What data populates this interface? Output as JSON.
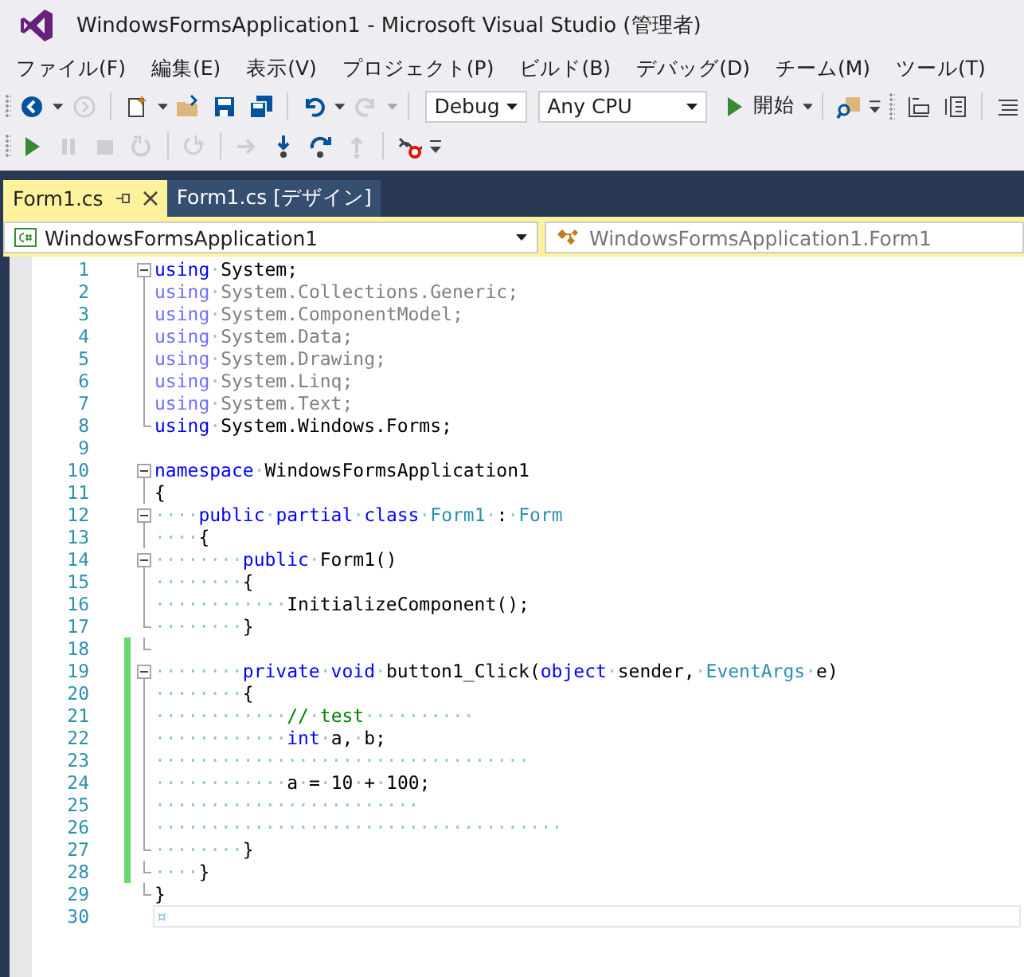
{
  "window": {
    "title": "WindowsFormsApplication1 - Microsoft Visual Studio (管理者)"
  },
  "menu": [
    "ファイル(F)",
    "編集(E)",
    "表示(V)",
    "プロジェクト(P)",
    "ビルド(B)",
    "デバッグ(D)",
    "チーム(M)",
    "ツール(T)"
  ],
  "toolbar_standard": [
    {
      "kind": "back",
      "disabled": false
    },
    {
      "kind": "caret",
      "disabled": false
    },
    {
      "kind": "forward",
      "disabled": true
    },
    {
      "kind": "sep"
    },
    {
      "kind": "new",
      "disabled": false
    },
    {
      "kind": "caret",
      "disabled": false
    },
    {
      "kind": "open",
      "disabled": false
    },
    {
      "kind": "save",
      "disabled": false
    },
    {
      "kind": "saveall",
      "disabled": false
    },
    {
      "kind": "sep"
    },
    {
      "kind": "undo",
      "disabled": false
    },
    {
      "kind": "caret",
      "disabled": false
    },
    {
      "kind": "redo",
      "disabled": true
    },
    {
      "kind": "caret",
      "disabled": true
    },
    {
      "kind": "sep"
    },
    {
      "kind": "combo",
      "value": "Debug"
    },
    {
      "kind": "combo-wide",
      "value": "Any CPU"
    },
    {
      "kind": "start",
      "label": "開始"
    },
    {
      "kind": "caret",
      "disabled": false
    },
    {
      "kind": "sep"
    },
    {
      "kind": "find",
      "disabled": false
    },
    {
      "kind": "overflow",
      "disabled": false
    },
    {
      "kind": "grip"
    },
    {
      "kind": "align",
      "disabled": false
    },
    {
      "kind": "columns",
      "disabled": false
    },
    {
      "kind": "sep"
    },
    {
      "kind": "lines",
      "disabled": false
    }
  ],
  "toolbar_debug": [
    {
      "kind": "play",
      "disabled": false
    },
    {
      "kind": "pause",
      "disabled": true
    },
    {
      "kind": "stop",
      "disabled": true
    },
    {
      "kind": "restart",
      "disabled": true
    },
    {
      "kind": "sep"
    },
    {
      "kind": "apply",
      "disabled": true
    },
    {
      "kind": "sep"
    },
    {
      "kind": "next",
      "disabled": true
    },
    {
      "kind": "stepinto",
      "disabled": false
    },
    {
      "kind": "stepover",
      "disabled": false
    },
    {
      "kind": "stepout",
      "disabled": true
    },
    {
      "kind": "sep"
    },
    {
      "kind": "breakpoints",
      "disabled": false
    },
    {
      "kind": "overflow",
      "disabled": false
    }
  ],
  "tabs": [
    {
      "label": "Form1.cs",
      "selected": true
    },
    {
      "label": "Form1.cs [デザイン]",
      "selected": false
    }
  ],
  "nav_bar": {
    "project": "WindowsFormsApplication1",
    "type": "WindowsFormsApplication1.Form1"
  },
  "lines": [
    {
      "number": "1",
      "changed": false,
      "current": false,
      "kind": "box",
      "code": [
        {
          "kind": "kw",
          "text": "using"
        },
        {
          "kind": "ws",
          "text": "·"
        },
        {
          "kind": "text",
          "text": "System;"
        }
      ]
    },
    {
      "number": "2",
      "changed": false,
      "current": false,
      "kind": "line",
      "code": [
        {
          "kind": "dimkw",
          "text": "using"
        },
        {
          "kind": "ws",
          "text": "·"
        },
        {
          "kind": "dim",
          "text": "System.Collections.Generic;"
        }
      ]
    },
    {
      "number": "3",
      "changed": false,
      "current": false,
      "kind": "line",
      "code": [
        {
          "kind": "dimkw",
          "text": "using"
        },
        {
          "kind": "ws",
          "text": "·"
        },
        {
          "kind": "dim",
          "text": "System.ComponentModel;"
        }
      ]
    },
    {
      "number": "4",
      "changed": false,
      "current": false,
      "kind": "line",
      "code": [
        {
          "kind": "dimkw",
          "text": "using"
        },
        {
          "kind": "ws",
          "text": "·"
        },
        {
          "kind": "dim",
          "text": "System.Data;"
        }
      ]
    },
    {
      "number": "5",
      "changed": false,
      "current": false,
      "kind": "line",
      "code": [
        {
          "kind": "dimkw",
          "text": "using"
        },
        {
          "kind": "ws",
          "text": "·"
        },
        {
          "kind": "dim",
          "text": "System.Drawing;"
        }
      ]
    },
    {
      "number": "6",
      "changed": false,
      "current": false,
      "kind": "line",
      "code": [
        {
          "kind": "dimkw",
          "text": "using"
        },
        {
          "kind": "ws",
          "text": "·"
        },
        {
          "kind": "dim",
          "text": "System.Linq;"
        }
      ]
    },
    {
      "number": "7",
      "changed": false,
      "current": false,
      "kind": "line",
      "code": [
        {
          "kind": "dimkw",
          "text": "using"
        },
        {
          "kind": "ws",
          "text": "·"
        },
        {
          "kind": "dim",
          "text": "System.Text;"
        }
      ]
    },
    {
      "number": "8",
      "changed": false,
      "current": false,
      "kind": "end",
      "code": [
        {
          "kind": "kw",
          "text": "using"
        },
        {
          "kind": "ws",
          "text": "·"
        },
        {
          "kind": "text",
          "text": "System.Windows.Forms;"
        }
      ]
    },
    {
      "number": "9",
      "changed": false,
      "current": false,
      "kind": "none"
    },
    {
      "number": "10",
      "changed": false,
      "current": false,
      "kind": "box",
      "code": [
        {
          "kind": "kw",
          "text": "namespace"
        },
        {
          "kind": "ws",
          "text": "·"
        },
        {
          "kind": "text",
          "text": "WindowsFormsApplication1"
        }
      ]
    },
    {
      "number": "11",
      "changed": false,
      "current": false,
      "kind": "line",
      "code": [
        {
          "kind": "text",
          "text": "{"
        }
      ]
    },
    {
      "number": "12",
      "changed": false,
      "current": false,
      "kind": "box",
      "code": [
        {
          "kind": "ws",
          "text": "····"
        },
        {
          "kind": "kw",
          "text": "public"
        },
        {
          "kind": "ws",
          "text": "·"
        },
        {
          "kind": "kw",
          "text": "partial"
        },
        {
          "kind": "ws",
          "text": "·"
        },
        {
          "kind": "kw",
          "text": "class"
        },
        {
          "kind": "ws",
          "text": "·"
        },
        {
          "kind": "type",
          "text": "Form1"
        },
        {
          "kind": "ws",
          "text": "·"
        },
        {
          "kind": "text",
          "text": ":"
        },
        {
          "kind": "ws",
          "text": "·"
        },
        {
          "kind": "type",
          "text": "Form"
        }
      ]
    },
    {
      "number": "13",
      "changed": false,
      "current": false,
      "kind": "line",
      "code": [
        {
          "kind": "ws",
          "text": "····"
        },
        {
          "kind": "text",
          "text": "{"
        }
      ]
    },
    {
      "number": "14",
      "changed": false,
      "current": false,
      "kind": "box",
      "code": [
        {
          "kind": "ws",
          "text": "········"
        },
        {
          "kind": "kw",
          "text": "public"
        },
        {
          "kind": "ws",
          "text": "·"
        },
        {
          "kind": "text",
          "text": "Form1()"
        }
      ]
    },
    {
      "number": "15",
      "changed": false,
      "current": false,
      "kind": "line",
      "code": [
        {
          "kind": "ws",
          "text": "········"
        },
        {
          "kind": "text",
          "text": "{"
        }
      ]
    },
    {
      "number": "16",
      "changed": false,
      "current": false,
      "kind": "line",
      "code": [
        {
          "kind": "ws",
          "text": "············"
        },
        {
          "kind": "text",
          "text": "InitializeComponent();"
        }
      ]
    },
    {
      "number": "17",
      "changed": false,
      "current": false,
      "kind": "end",
      "code": [
        {
          "kind": "ws",
          "text": "········"
        },
        {
          "kind": "text",
          "text": "}"
        }
      ]
    },
    {
      "number": "18",
      "changed": true,
      "current": false,
      "kind": "end"
    },
    {
      "number": "19",
      "changed": true,
      "current": false,
      "kind": "box",
      "code": [
        {
          "kind": "ws",
          "text": "········"
        },
        {
          "kind": "kw",
          "text": "private"
        },
        {
          "kind": "ws",
          "text": "·"
        },
        {
          "kind": "kw",
          "text": "void"
        },
        {
          "kind": "ws",
          "text": "·"
        },
        {
          "kind": "text",
          "text": "button1_Click("
        },
        {
          "kind": "kw",
          "text": "object"
        },
        {
          "kind": "ws",
          "text": "·"
        },
        {
          "kind": "text",
          "text": "sender,"
        },
        {
          "kind": "ws",
          "text": "·"
        },
        {
          "kind": "type",
          "text": "EventArgs"
        },
        {
          "kind": "ws",
          "text": "·"
        },
        {
          "kind": "text",
          "text": "e)"
        }
      ]
    },
    {
      "number": "20",
      "changed": true,
      "current": false,
      "kind": "line",
      "code": [
        {
          "kind": "ws",
          "text": "········"
        },
        {
          "kind": "text",
          "text": "{"
        }
      ]
    },
    {
      "number": "21",
      "changed": true,
      "current": false,
      "kind": "line",
      "code": [
        {
          "kind": "ws",
          "text": "············"
        },
        {
          "kind": "comment",
          "text": "//"
        },
        {
          "kind": "ws",
          "text": "·"
        },
        {
          "kind": "comment",
          "text": "test"
        },
        {
          "kind": "ws",
          "text": "··········"
        }
      ]
    },
    {
      "number": "22",
      "changed": true,
      "current": false,
      "kind": "line",
      "code": [
        {
          "kind": "ws",
          "text": "············"
        },
        {
          "kind": "kw",
          "text": "int"
        },
        {
          "kind": "ws",
          "text": "·"
        },
        {
          "kind": "text",
          "text": "a,"
        },
        {
          "kind": "ws",
          "text": "·"
        },
        {
          "kind": "text",
          "text": "b;"
        }
      ]
    },
    {
      "number": "23",
      "changed": true,
      "current": false,
      "kind": "line",
      "code": [
        {
          "kind": "ws",
          "text": "··································"
        }
      ]
    },
    {
      "number": "24",
      "changed": true,
      "current": false,
      "kind": "line",
      "code": [
        {
          "kind": "ws",
          "text": "············"
        },
        {
          "kind": "text",
          "text": "a"
        },
        {
          "kind": "ws",
          "text": "·"
        },
        {
          "kind": "text",
          "text": "="
        },
        {
          "kind": "ws",
          "text": "·"
        },
        {
          "kind": "text",
          "text": "10"
        },
        {
          "kind": "ws",
          "text": "·"
        },
        {
          "kind": "text",
          "text": "+"
        },
        {
          "kind": "ws",
          "text": "·"
        },
        {
          "kind": "text",
          "text": "100;"
        }
      ]
    },
    {
      "number": "25",
      "changed": true,
      "current": false,
      "kind": "line",
      "code": [
        {
          "kind": "ws",
          "text": "························"
        }
      ]
    },
    {
      "number": "26",
      "changed": true,
      "current": false,
      "kind": "line",
      "code": [
        {
          "kind": "ws",
          "text": "·····································"
        }
      ]
    },
    {
      "number": "27",
      "changed": true,
      "current": false,
      "kind": "end",
      "code": [
        {
          "kind": "ws",
          "text": "········"
        },
        {
          "kind": "text",
          "text": "}"
        }
      ]
    },
    {
      "number": "28",
      "changed": true,
      "current": false,
      "kind": "end",
      "code": [
        {
          "kind": "ws",
          "text": "····"
        },
        {
          "kind": "text",
          "text": "}"
        }
      ]
    },
    {
      "number": "29",
      "changed": false,
      "current": false,
      "kind": "end",
      "code": [
        {
          "kind": "text",
          "text": "}"
        }
      ]
    },
    {
      "number": "30",
      "changed": false,
      "current": true,
      "kind": "none",
      "code": [
        {
          "kind": "ws",
          "text": "¤"
        }
      ]
    }
  ]
}
